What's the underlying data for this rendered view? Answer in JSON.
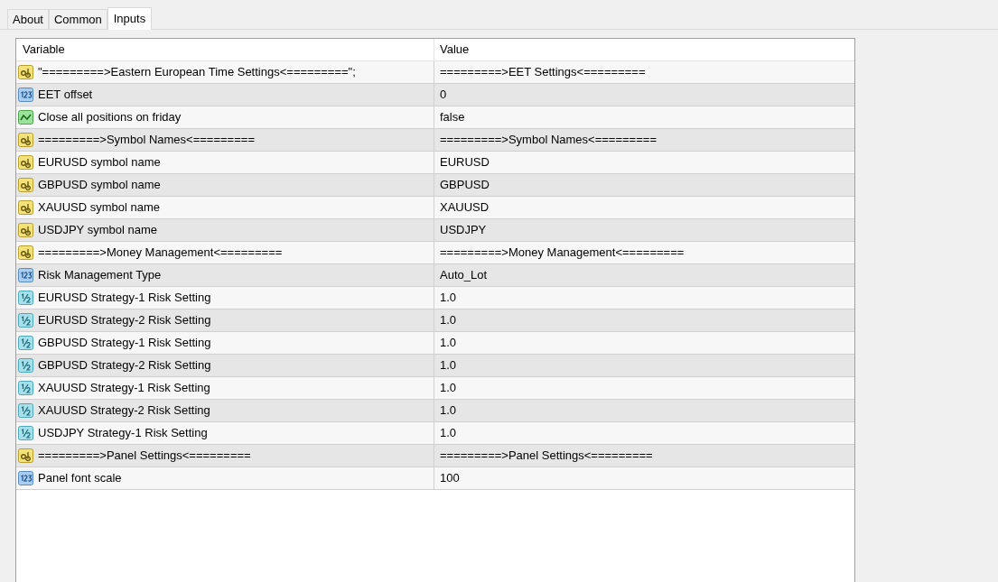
{
  "tabs": [
    {
      "label": "About",
      "selected": false
    },
    {
      "label": "Common",
      "selected": false
    },
    {
      "label": "Inputs",
      "selected": true
    }
  ],
  "table": {
    "columns": [
      "Variable",
      "Value"
    ],
    "rows": [
      {
        "kind": "string",
        "variable": "\"=========>Eastern European Time Settings<=========\";",
        "value": "=========>EET Settings<========="
      },
      {
        "kind": "integer",
        "variable": "EET offset",
        "value": "0"
      },
      {
        "kind": "bool",
        "variable": "Close all positions on friday",
        "value": "false"
      },
      {
        "kind": "string",
        "variable": "=========>Symbol Names<=========",
        "value": "=========>Symbol Names<========="
      },
      {
        "kind": "string",
        "variable": "EURUSD symbol name",
        "value": "EURUSD"
      },
      {
        "kind": "string",
        "variable": "GBPUSD symbol name",
        "value": "GBPUSD"
      },
      {
        "kind": "string",
        "variable": "XAUUSD symbol name",
        "value": "XAUUSD"
      },
      {
        "kind": "string",
        "variable": "USDJPY symbol name",
        "value": "USDJPY"
      },
      {
        "kind": "string",
        "variable": "=========>Money Management<=========",
        "value": "=========>Money Management<========="
      },
      {
        "kind": "integer",
        "variable": "Risk Management Type",
        "value": "Auto_Lot"
      },
      {
        "kind": "double",
        "variable": "EURUSD Strategy-1 Risk Setting",
        "value": "1.0"
      },
      {
        "kind": "double",
        "variable": "EURUSD Strategy-2 Risk Setting",
        "value": "1.0"
      },
      {
        "kind": "double",
        "variable": "GBPUSD Strategy-1 Risk Setting",
        "value": "1.0"
      },
      {
        "kind": "double",
        "variable": "GBPUSD Strategy-2 Risk Setting",
        "value": "1.0"
      },
      {
        "kind": "double",
        "variable": "XAUUSD Strategy-1 Risk Setting",
        "value": "1.0"
      },
      {
        "kind": "double",
        "variable": "XAUUSD Strategy-2 Risk Setting",
        "value": "1.0"
      },
      {
        "kind": "double",
        "variable": "USDJPY Strategy-1 Risk Setting",
        "value": "1.0"
      },
      {
        "kind": "string",
        "variable": "=========>Panel Settings<=========",
        "value": "=========>Panel Settings<========="
      },
      {
        "kind": "integer",
        "variable": "Panel font scale",
        "value": "100"
      }
    ]
  }
}
